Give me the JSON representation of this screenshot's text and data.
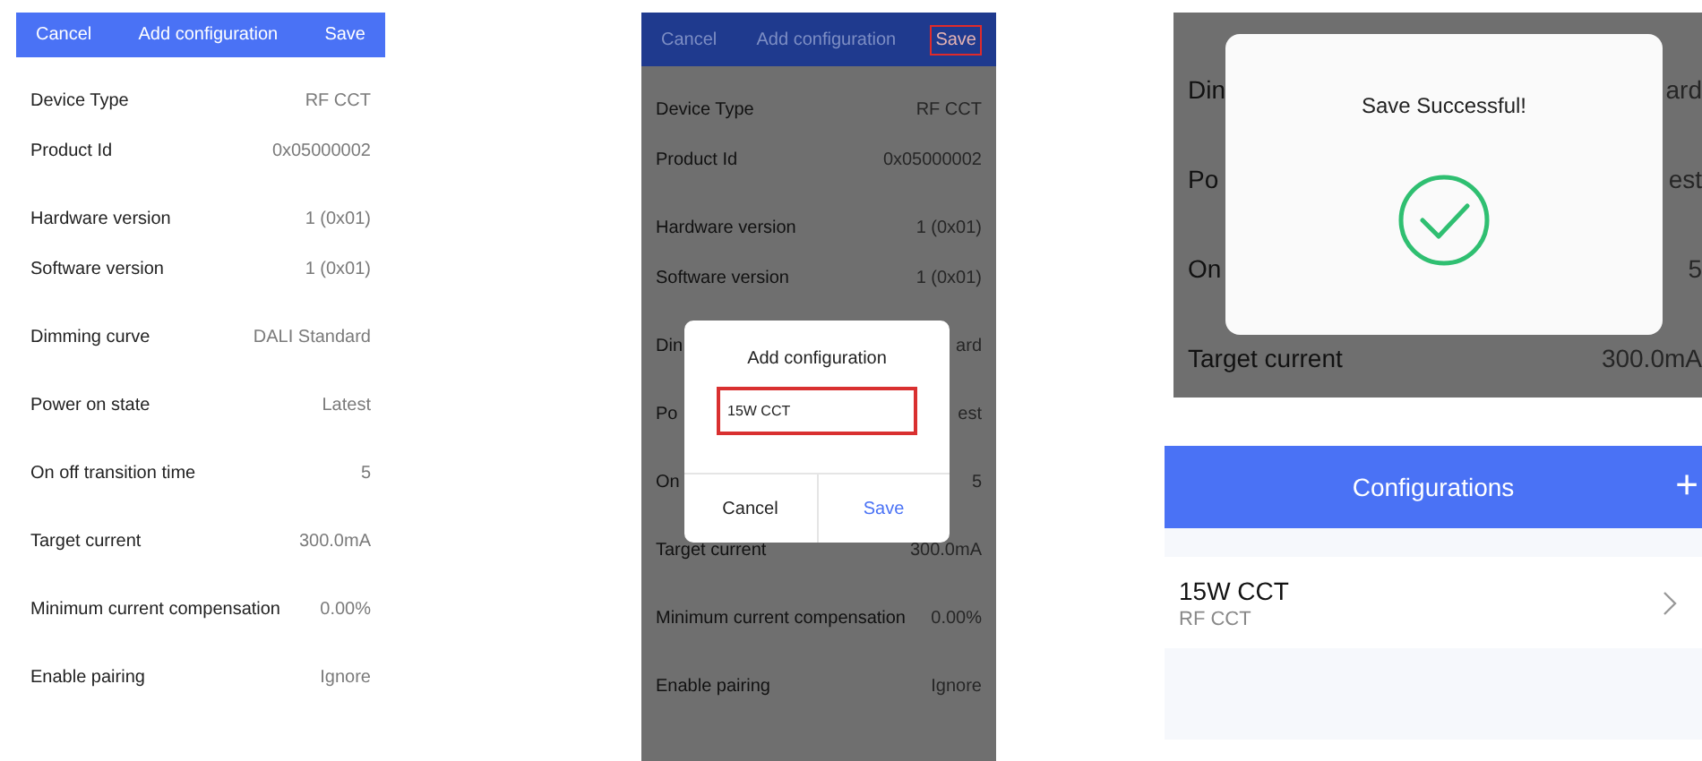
{
  "columns": [
    {
      "screens": [
        {
          "kind": "form",
          "dimmed": false,
          "header": {
            "cancel": "Cancel",
            "title": "Add configuration",
            "save": "Save",
            "save_highlighted": false
          },
          "sections": [
            [
              {
                "label": "Device Type",
                "value": "RF CCT"
              },
              {
                "label": "Product Id",
                "value": "0x05000002"
              }
            ],
            [
              {
                "label": "Hardware version",
                "value": "1 (0x01)"
              },
              {
                "label": "Software version",
                "value": "1 (0x01)"
              }
            ],
            [
              {
                "label": "Dimming curve",
                "value": "DALI Standard"
              }
            ],
            [
              {
                "label": "Power on state",
                "value": "Latest"
              }
            ],
            [
              {
                "label": "On off transition time",
                "value": "5"
              }
            ],
            [
              {
                "label": "Target current",
                "value": "300.0mA"
              }
            ],
            [
              {
                "label": "Minimum current compensation",
                "value": "0.00%"
              }
            ],
            [
              {
                "label": "Enable pairing",
                "value": "Ignore"
              }
            ]
          ]
        }
      ]
    },
    {
      "screens": [
        {
          "kind": "form",
          "dimmed": true,
          "header": {
            "cancel": "Cancel",
            "title": "Add configuration",
            "save": "Save",
            "save_highlighted": true
          },
          "sections": [
            [
              {
                "label": "Device Type",
                "value": "RF CCT"
              },
              {
                "label": "Product Id",
                "value": "0x05000002"
              }
            ],
            [
              {
                "label": "Hardware version",
                "value": "1 (0x01)"
              },
              {
                "label": "Software version",
                "value": "1 (0x01)"
              }
            ],
            [
              {
                "label": "Din",
                "value": "ard"
              }
            ],
            [
              {
                "label": "Po",
                "value": "est"
              }
            ],
            [
              {
                "label": "On",
                "value": "5"
              }
            ],
            [
              {
                "label": "Target current",
                "value": "300.0mA"
              }
            ],
            [
              {
                "label": "Minimum current compensation",
                "value": "0.00%"
              }
            ],
            [
              {
                "label": "Enable pairing",
                "value": "Ignore"
              }
            ]
          ],
          "dialog": {
            "title": "Add configuration",
            "input": {
              "value": "15W CCT",
              "highlighted": true
            },
            "buttons": [
              {
                "label": "Cancel",
                "primary": false
              },
              {
                "label": "Save",
                "primary": true
              }
            ]
          }
        }
      ]
    },
    {
      "screens": [
        {
          "kind": "saved",
          "dimmed": true,
          "sections": [
            [
              {
                "label": "Din",
                "value": "ard"
              }
            ],
            [
              {
                "label": "Po",
                "value": "est"
              }
            ],
            [
              {
                "label": "On",
                "value": "5"
              }
            ],
            [
              {
                "label": "Target current",
                "value": "300.0mA"
              }
            ]
          ],
          "toast": {
            "message": "Save Successful!"
          }
        },
        {
          "kind": "list",
          "title": "Configurations",
          "add": "+",
          "items": [
            {
              "name": "15W CCT",
              "type": "RF CCT"
            }
          ]
        }
      ]
    }
  ]
}
